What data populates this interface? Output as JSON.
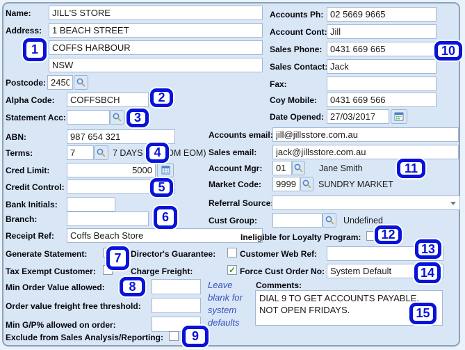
{
  "page": {
    "fields": {
      "name": {
        "label": "Name:",
        "value": "JILL'S STORE"
      },
      "address": {
        "label": "Address:",
        "line1": "1 BEACH STREET",
        "line2": "COFFS HARBOUR",
        "line3": "NSW"
      },
      "postcode": {
        "label": "Postcode:",
        "value": "2450"
      },
      "alpha_code": {
        "label": "Alpha Code:",
        "value": "COFFSBCH"
      },
      "statement_acc": {
        "label": "Statement Acc:",
        "value": ""
      },
      "abn": {
        "label": "ABN:",
        "value": "987 654 321"
      },
      "terms": {
        "label": "Terms:",
        "code": "7",
        "description": "7 DAYS (7 FROM EOM)"
      },
      "cred_limit": {
        "label": "Cred Limit:",
        "value": "5000"
      },
      "credit_control": {
        "label": "Credit Control:",
        "value": ""
      },
      "bank_initials": {
        "label": "Bank Initials:",
        "value": ""
      },
      "branch": {
        "label": "Branch:",
        "value": ""
      },
      "receipt_ref": {
        "label": "Receipt Ref:",
        "value": "Coffs Beach Store"
      },
      "generate_statement": {
        "label": "Generate Statement:",
        "checked": false
      },
      "directors_guarantee": {
        "label": "Director's Guarantee:",
        "checked": false
      },
      "tax_exempt_customer": {
        "label": "Tax Exempt Customer:",
        "checked": false
      },
      "charge_freight": {
        "label": "Charge Freight:",
        "checked": true
      },
      "min_order_value": {
        "label": "Min Order Value allowed:",
        "value": ""
      },
      "freight_free_threshold": {
        "label": "Order value freight free threshold:",
        "value": ""
      },
      "min_gp": {
        "label": "Min G/P% allowed on order:",
        "value": ""
      },
      "exclude_sales_analysis": {
        "label": "Exclude from Sales Analysis/Reporting:",
        "checked": false
      },
      "defaults_note": "Leave blank for system defaults",
      "accounts_ph": {
        "label": "Accounts Ph:",
        "value": "02 5669 9665"
      },
      "account_cont": {
        "label": "Account Cont:",
        "value": "Jill"
      },
      "sales_phone": {
        "label": "Sales Phone:",
        "value": "0431 669 665"
      },
      "sales_contact": {
        "label": "Sales Contact:",
        "value": "Jack"
      },
      "fax": {
        "label": "Fax:",
        "value": ""
      },
      "coy_mobile": {
        "label": "Coy Mobile:",
        "value": "0431 669 566"
      },
      "date_opened": {
        "label": "Date Opened:",
        "value": "27/03/2017"
      },
      "accounts_email": {
        "label": "Accounts email:",
        "value": "jill@jillsstore.com.au"
      },
      "sales_email": {
        "label": "Sales email:",
        "value": "jack@jillsstore.com.au"
      },
      "account_mgr": {
        "label": "Account Mgr:",
        "code": "01",
        "name": "Jane Smith"
      },
      "market_code": {
        "label": "Market Code:",
        "code": "9999",
        "name": "SUNDRY MARKET"
      },
      "referral_source": {
        "label": "Referral Source:",
        "value": ""
      },
      "cust_group": {
        "label": "Cust Group:",
        "value": "",
        "name": "Undefined"
      },
      "ineligible_loyalty": {
        "label": "Ineligible for Loyalty Program:",
        "checked": false
      },
      "customer_web_ref": {
        "label": "Customer Web Ref:",
        "value": ""
      },
      "force_cust_order_no": {
        "label": "Force Cust Order No:",
        "value": "System Default"
      },
      "comments": {
        "label": "Comments:",
        "value": "DIAL 9 TO GET ACCOUNTS PAYABLE.\nNOT OPEN FRIDAYS."
      }
    },
    "callouts": [
      "1",
      "2",
      "3",
      "4",
      "5",
      "6",
      "7",
      "8",
      "9",
      "10",
      "11",
      "12",
      "13",
      "14",
      "15"
    ],
    "colors": {
      "callout_blue": "#0713d9",
      "check_green": "#2c9a2c",
      "note_blue": "#3a50c0"
    }
  }
}
